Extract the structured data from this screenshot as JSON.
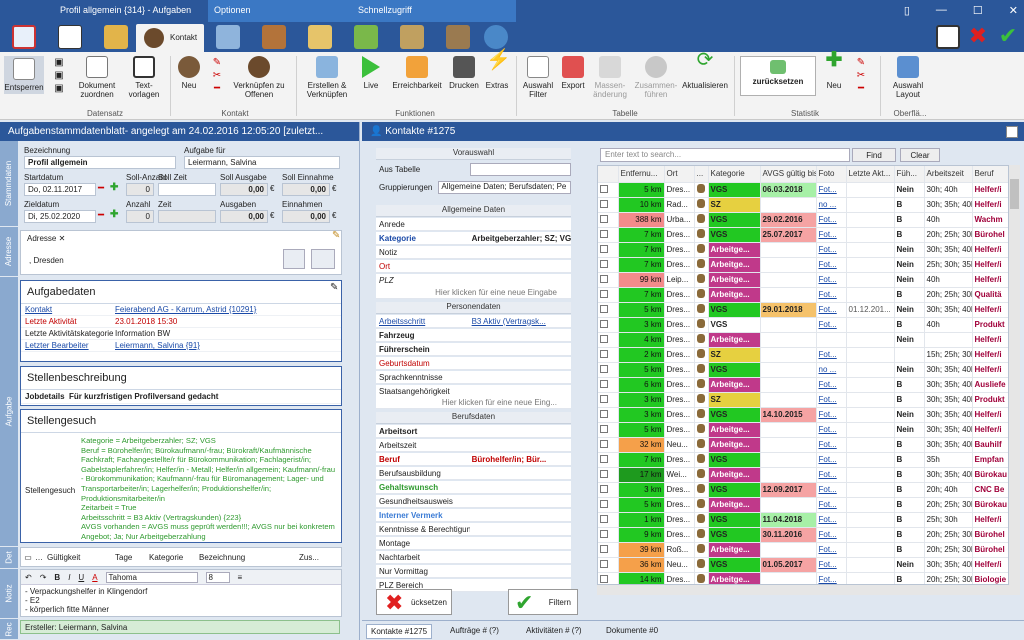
{
  "window": {
    "title": "Profil allgemein {314} - Aufgaben",
    "context_tab_1": "Optionen",
    "context_tab_2": "Schnellzugriff"
  },
  "tabs": {
    "active": "Kontakt"
  },
  "ribbon": {
    "buttons": {
      "entsperren": "Entsperren",
      "dokument": "Dokument zuordnen",
      "textvorlagen": "Text-vorlagen",
      "neu": "Neu",
      "verknuepfen": "Verknüpfen zu Offenen",
      "erstellen": "Erstellen & Verknüpfen",
      "live": "Live",
      "erreichbarkeit": "Erreichbarkeit",
      "drucken": "Drucken",
      "extras": "Extras",
      "auswahl_filter": "Auswahl Filter",
      "export": "Export",
      "massenaenderung": "Massen-änderung",
      "zusammenfuehren": "Zusammen-führen",
      "aktualisieren": "Aktualisieren",
      "zuruecksetzen": "zurücksetzen",
      "neu2": "Neu",
      "auswahl_layout": "Auswahl Layout"
    },
    "groups": {
      "datensatz": "Datensatz",
      "kontakt": "Kontakt",
      "funktionen": "Funktionen",
      "tabelle": "Tabelle",
      "statistik": "Statistik",
      "oberflaeche": "Oberflä..."
    }
  },
  "left": {
    "header": "Aufgabenstammdatenblatt- angelegt am 24.02.2016 12:05:20 [zuletzt...",
    "vtabs": {
      "stammdaten": "Stammdaten",
      "adresse": "Adresse",
      "aufgabe": "Aufgabe",
      "det": "Det",
      "notiz": "Notiz",
      "rec": "Rec"
    },
    "form": {
      "bezeichnung_label": "Bezeichnung",
      "bezeichnung": "Profil allgemein",
      "aufgabe_fuer_label": "Aufgabe für",
      "aufgabe_fuer": "Leiermann, Salvina",
      "startdatum_label": "Startdatum",
      "startdatum": "Do, 02.11.2017",
      "soll_anzahl_label": "Soll-Anzahl",
      "soll_anzahl": "0",
      "soll_zeit_label": "Soll Zeit",
      "soll_ausgabe_label": "Soll Ausgabe",
      "soll_ausgabe": "0,00",
      "soll_einnahme_label": "Soll Einnahme",
      "soll_einnahme": "0,00",
      "zieldatum_label": "Zieldatum",
      "zieldatum": "Di, 25.02.2020",
      "anzahl_label": "Anzahl",
      "anzahl": "0",
      "zeit_label": "Zeit",
      "ausgaben_label": "Ausgaben",
      "ausgaben": "0,00",
      "einnahmen_label": "Einnahmen",
      "einnahmen": "0,00",
      "currency": "€"
    },
    "adresse": {
      "tab": "Adresse",
      "text": ", Dresden"
    },
    "aufgabedaten": {
      "title": "Aufgabedaten",
      "rows": [
        {
          "k": "Kontakt",
          "v": "Feierabend AG - Karrum, Astrid {10291}"
        },
        {
          "k": "Letzte Aktivität",
          "v": "23.01.2018 15:30"
        },
        {
          "k": "Letzte Aktivitätskategorie",
          "v": "Information BW"
        },
        {
          "k": "Letzter Bearbeiter",
          "v": "Leiermann, Salvina {91}"
        }
      ]
    },
    "stellenbeschreibung": {
      "title": "Stellenbeschreibung",
      "k": "Jobdetails",
      "v": "Für kurzfristigen Profilversand gedacht"
    },
    "stellengesuch": {
      "title": "Stellengesuch",
      "k": "Stellengesuch",
      "lines": [
        "Kategorie = Arbeitgeberzahler; SZ; VGS",
        "Beruf = Bürohelfer/in; Bürokaufmann/-frau; Bürokraft/Kaufmännische",
        "Fachkraft; Fachangestellte/r für Bürokommunikation; Fachlagerist/in;",
        "Gabelstaplerfahrer/in; Helfer/in - Metall; Helfer/in allgemein; Kaufmann/-frau",
        "- Bürokommunikation; Kaufmann/-frau für Büromanagement; Lager- und",
        "Transportarbeiter/in; Lagerhelfer/in; Produktionshelfer/in;",
        "Produktionsmitarbeiter/in",
        "Zeitarbeit = True",
        "Arbeitsschritt = B3 Aktiv (Vertragskunden) {223}",
        "AVGS vorhanden = AVGS muss geprüft werden!!!; AVGS nur bei konkretem",
        "Angebot; Ja; Nur Arbeitgeberzahlung"
      ]
    },
    "det_cols": [
      "Gültigkeit",
      "Tage",
      "Kategorie",
      "Bezeichnung",
      "Zus..."
    ],
    "editor": {
      "font": "Tahoma",
      "size": "8",
      "b": "B",
      "i": "I",
      "u": "U",
      "a": "A"
    },
    "notiz_lines": [
      "- Verpackungshelfer in Klingendorf",
      "- E2",
      "- körperlich fitte Männer"
    ],
    "rec": "Ersteller: Leiermann, Salvina"
  },
  "mid": {
    "header": "Kontakte #1275",
    "vorauswahl": "Vorauswahl",
    "aus_tabelle": "Aus Tabelle",
    "gruppierungen_label": "Gruppierungen",
    "gruppierungen": "Allgemeine Daten; Berufsdaten; Pe",
    "allgemeine": "Allgemeine Daten",
    "ad_rows": [
      {
        "k": "Anrede",
        "v": ""
      },
      {
        "k": "Kategorie",
        "v": "Arbeitgeberzahler; SZ; VGS"
      },
      {
        "k": "Notiz",
        "v": ""
      },
      {
        "k": "Ort",
        "v": ""
      },
      {
        "k": "PLZ",
        "v": ""
      }
    ],
    "hint1": "Hier klicken für eine neue Eingabe",
    "personendaten": "Personendaten",
    "pd_rows": [
      {
        "k": "Arbeitsschritt",
        "v": "B3 Aktiv (Vertragsk..."
      },
      {
        "k": "Fahrzeug",
        "v": ""
      },
      {
        "k": "Führerschein",
        "v": ""
      },
      {
        "k": "Geburtsdatum",
        "v": ""
      },
      {
        "k": "Sprachkenntnisse",
        "v": ""
      },
      {
        "k": "Staatsangehörigkeit",
        "v": ""
      }
    ],
    "hint2": "Hier klicken für eine neue Eing...",
    "berufsdaten": "Berufsdaten",
    "bd_rows": [
      {
        "k": "Arbeitsort",
        "v": ""
      },
      {
        "k": "Arbeitszeit",
        "v": ""
      },
      {
        "k": "Beruf",
        "v": "Bürohelfer/in; Bür..."
      },
      {
        "k": "Berufsausbildung",
        "v": ""
      },
      {
        "k": "Gehaltswunsch",
        "v": ""
      },
      {
        "k": "Gesundheitsausweis",
        "v": ""
      },
      {
        "k": "Interner Vermerk",
        "v": ""
      },
      {
        "k": "Kenntnisse & Berechtigungen",
        "v": ""
      },
      {
        "k": "Montage",
        "v": ""
      },
      {
        "k": "Nachtarbeit",
        "v": ""
      },
      {
        "k": "Nur Vormittag",
        "v": ""
      },
      {
        "k": "PLZ Bereich",
        "v": ""
      }
    ],
    "reset_btn": "ücksetzen",
    "filter_btn": "Filtern"
  },
  "grid": {
    "search_placeholder": "Enter text to search...",
    "find": "Find",
    "clear": "Clear",
    "columns": [
      "",
      "Entfernu...",
      "Ort",
      "...",
      "Kategorie",
      "AVGS gültig bis",
      "Foto",
      "Letzte Akt...",
      "Füh...",
      "Arbeitszeit",
      "Beruf"
    ],
    "rows": [
      {
        "km": "5 km",
        "kmc": "#22c822",
        "ort": "Dres...",
        "kat": "VGS",
        "katc": "#22c822",
        "avgs": "06.03.2018",
        "avc": "#a7f0a7",
        "foto": "Fot...",
        "akt": "",
        "fue": "Nein",
        "az": "30h; 40h",
        "beruf": "Helfer/i"
      },
      {
        "km": "10 km",
        "kmc": "#22c822",
        "ort": "Rad...",
        "kat": "SZ",
        "katc": "#e6d040",
        "avgs": "",
        "avc": "",
        "foto": "no ...",
        "akt": "",
        "fue": "B",
        "az": "30h; 35h; 40h",
        "beruf": "Helfer/i"
      },
      {
        "km": "388 km",
        "kmc": "#f28b8b",
        "ort": "Urba...",
        "kat": "VGS",
        "katc": "#22c822",
        "avgs": "29.02.2016",
        "avc": "#f5a3a3",
        "foto": "Fot...",
        "akt": "",
        "fue": "B",
        "az": "40h",
        "beruf": "Wachm"
      },
      {
        "km": "7 km",
        "kmc": "#22c822",
        "ort": "Dres...",
        "kat": "VGS",
        "katc": "#22c822",
        "avgs": "25.07.2017",
        "avc": "#f5a3a3",
        "foto": "Fot...",
        "akt": "",
        "fue": "B",
        "az": "20h; 25h; 30h",
        "beruf": "Bürohel"
      },
      {
        "km": "7 km",
        "kmc": "#22c822",
        "ort": "Dres...",
        "kat": "Arbeitge...",
        "katc": "#c0398a",
        "avgs": "",
        "avc": "",
        "foto": "Fot...",
        "akt": "",
        "fue": "Nein",
        "az": "30h; 35h; 40h",
        "beruf": "Helfer/i"
      },
      {
        "km": "7 km",
        "kmc": "#22c822",
        "ort": "Dres...",
        "kat": "Arbeitge...",
        "katc": "#c0398a",
        "avgs": "",
        "avc": "",
        "foto": "Fot...",
        "akt": "",
        "fue": "Nein",
        "az": "25h; 30h; 35h",
        "beruf": "Helfer/i"
      },
      {
        "km": "99 km",
        "kmc": "#f28b8b",
        "ort": "Leip...",
        "kat": "Arbeitge...",
        "katc": "#c0398a",
        "avgs": "",
        "avc": "",
        "foto": "Fot...",
        "akt": "",
        "fue": "Nein",
        "az": "40h",
        "beruf": "Helfer/i"
      },
      {
        "km": "7 km",
        "kmc": "#22c822",
        "ort": "Dres...",
        "kat": "Arbeitge...",
        "katc": "#c0398a",
        "avgs": "",
        "avc": "",
        "foto": "Fot...",
        "akt": "",
        "fue": "B",
        "az": "20h; 25h; 30h",
        "beruf": "Qualitä"
      },
      {
        "km": "5 km",
        "kmc": "#22c822",
        "ort": "Dres...",
        "kat": "VGS",
        "katc": "#22c822",
        "avgs": "29.01.2018",
        "avc": "#f5c26b",
        "foto": "Fot...",
        "akt": "01.12.201...",
        "fue": "Nein",
        "az": "30h; 35h; 40h",
        "beruf": "Helfer/i"
      },
      {
        "km": "3 km",
        "kmc": "#22c822",
        "ort": "Dres...",
        "kat": "VGS",
        "katc": "#ffffff",
        "avgs": "",
        "avc": "",
        "foto": "Fot...",
        "akt": "",
        "fue": "B",
        "az": "40h",
        "beruf": "Produkt"
      },
      {
        "km": "4 km",
        "kmc": "#22c822",
        "ort": "Dres...",
        "kat": "Arbeitge...",
        "katc": "#c0398a",
        "avgs": "",
        "avc": "",
        "foto": "",
        "akt": "",
        "fue": "Nein",
        "az": "",
        "beruf": "Helfer/i"
      },
      {
        "km": "2 km",
        "kmc": "#22c822",
        "ort": "Dres...",
        "kat": "SZ",
        "katc": "#e6d040",
        "avgs": "",
        "avc": "",
        "foto": "Fot...",
        "akt": "",
        "fue": "",
        "az": "15h; 25h; 30h",
        "beruf": "Helfer/i"
      },
      {
        "km": "5 km",
        "kmc": "#22c822",
        "ort": "Dres...",
        "kat": "VGS",
        "katc": "#22c822",
        "avgs": "",
        "avc": "",
        "foto": "no ...",
        "akt": "",
        "fue": "Nein",
        "az": "30h; 35h; 40h",
        "beruf": "Helfer/i"
      },
      {
        "km": "6 km",
        "kmc": "#22c822",
        "ort": "Dres...",
        "kat": "Arbeitge...",
        "katc": "#c0398a",
        "avgs": "",
        "avc": "",
        "foto": "Fot...",
        "akt": "",
        "fue": "B",
        "az": "30h; 35h; 40h",
        "beruf": "Ausliefe"
      },
      {
        "km": "3 km",
        "kmc": "#22c822",
        "ort": "Dres...",
        "kat": "SZ",
        "katc": "#e6d040",
        "avgs": "",
        "avc": "",
        "foto": "Fot...",
        "akt": "",
        "fue": "B",
        "az": "30h; 35h; 40h",
        "beruf": "Produkt"
      },
      {
        "km": "3 km",
        "kmc": "#22c822",
        "ort": "Dres...",
        "kat": "VGS",
        "katc": "#22c822",
        "avgs": "14.10.2015",
        "avc": "#f5a3a3",
        "foto": "Fot...",
        "akt": "",
        "fue": "Nein",
        "az": "30h; 35h; 40h",
        "beruf": "Helfer/i"
      },
      {
        "km": "5 km",
        "kmc": "#22c822",
        "ort": "Dres...",
        "kat": "Arbeitge...",
        "katc": "#c0398a",
        "avgs": "",
        "avc": "",
        "foto": "Fot...",
        "akt": "",
        "fue": "Nein",
        "az": "30h; 35h; 40h",
        "beruf": "Helfer/i"
      },
      {
        "km": "32 km",
        "kmc": "#f5a04a",
        "ort": "Neu...",
        "kat": "Arbeitge...",
        "katc": "#c0398a",
        "avgs": "",
        "avc": "",
        "foto": "Fot...",
        "akt": "",
        "fue": "B",
        "az": "30h; 35h; 40h",
        "beruf": "Bauhilf"
      },
      {
        "km": "7 km",
        "kmc": "#22c822",
        "ort": "Dres...",
        "kat": "VGS",
        "katc": "#22c822",
        "avgs": "",
        "avc": "",
        "foto": "Fot...",
        "akt": "",
        "fue": "B",
        "az": "35h",
        "beruf": "Empfan"
      },
      {
        "km": "17 km",
        "kmc": "#1e9a1e",
        "ort": "Wei...",
        "kat": "Arbeitge...",
        "katc": "#c0398a",
        "avgs": "",
        "avc": "",
        "foto": "Fot...",
        "akt": "",
        "fue": "B",
        "az": "30h; 35h; 40h",
        "beruf": "Bürokau"
      },
      {
        "km": "3 km",
        "kmc": "#22c822",
        "ort": "Dres...",
        "kat": "VGS",
        "katc": "#22c822",
        "avgs": "12.09.2017",
        "avc": "#f5a3a3",
        "foto": "Fot...",
        "akt": "",
        "fue": "B",
        "az": "20h; 40h",
        "beruf": "CNC Be"
      },
      {
        "km": "5 km",
        "kmc": "#22c822",
        "ort": "Dres...",
        "kat": "Arbeitge...",
        "katc": "#c0398a",
        "avgs": "",
        "avc": "",
        "foto": "Fot...",
        "akt": "",
        "fue": "B",
        "az": "20h; 25h; 30h",
        "beruf": "Bürokau"
      },
      {
        "km": "1 km",
        "kmc": "#22c822",
        "ort": "Dres...",
        "kat": "VGS",
        "katc": "#22c822",
        "avgs": "11.04.2018",
        "avc": "#a7f0a7",
        "foto": "Fot...",
        "akt": "",
        "fue": "B",
        "az": "25h; 30h",
        "beruf": "Helfer/i"
      },
      {
        "km": "9 km",
        "kmc": "#22c822",
        "ort": "Dres...",
        "kat": "VGS",
        "katc": "#22c822",
        "avgs": "30.11.2016",
        "avc": "#f5a3a3",
        "foto": "Fot...",
        "akt": "",
        "fue": "B",
        "az": "20h; 25h; 30h",
        "beruf": "Bürohel"
      },
      {
        "km": "39 km",
        "kmc": "#f5a04a",
        "ort": "Roß...",
        "kat": "Arbeitge...",
        "katc": "#c0398a",
        "avgs": "",
        "avc": "",
        "foto": "Fot...",
        "akt": "",
        "fue": "B",
        "az": "20h; 25h; 30h",
        "beruf": "Bürohel"
      },
      {
        "km": "36 km",
        "kmc": "#f5a04a",
        "ort": "Neu...",
        "kat": "VGS",
        "katc": "#22c822",
        "avgs": "01.05.2017",
        "avc": "#f5a3a3",
        "foto": "Fot...",
        "akt": "",
        "fue": "Nein",
        "az": "30h; 35h; 40h",
        "beruf": "Helfer/i"
      },
      {
        "km": "14 km",
        "kmc": "#22c822",
        "ort": "Dres...",
        "kat": "Arbeitge...",
        "katc": "#c0398a",
        "avgs": "",
        "avc": "",
        "foto": "Fot...",
        "akt": "",
        "fue": "B",
        "az": "20h; 25h; 30h",
        "beruf": "Biologie"
      }
    ]
  },
  "status_tabs": [
    "Kontakte #1275",
    "Aufträge # (?)",
    "Aktivitäten # (?)",
    "Dokumente #0"
  ]
}
